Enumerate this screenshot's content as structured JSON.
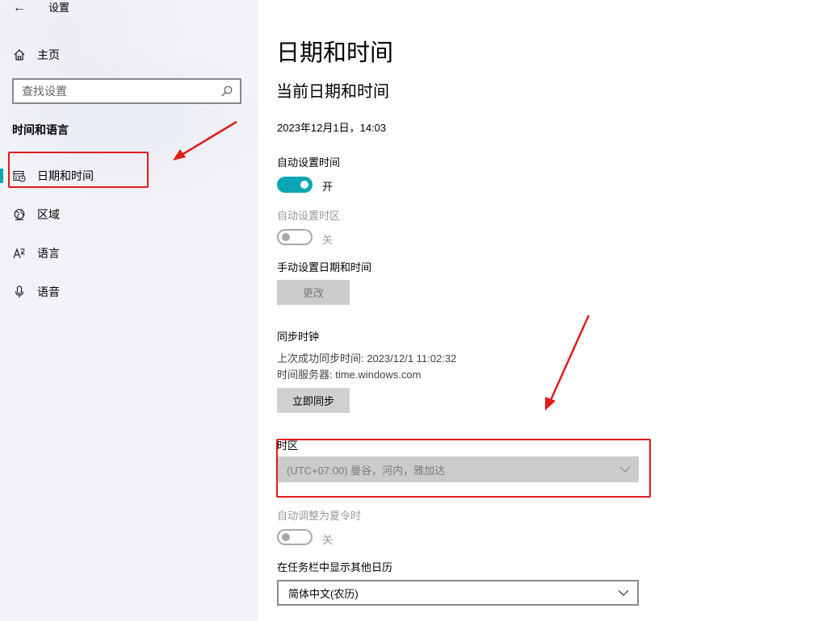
{
  "window": {
    "title": "设置",
    "back_glyph": "←"
  },
  "sidebar": {
    "home_label": "主页",
    "search_placeholder": "查找设置",
    "section_title": "时间和语言",
    "items": [
      {
        "label": "日期和时间",
        "icon": "calendar-clock-icon",
        "selected": true
      },
      {
        "label": "区域",
        "icon": "globe-icon",
        "selected": false
      },
      {
        "label": "语言",
        "icon": "language-icon",
        "selected": false
      },
      {
        "label": "语音",
        "icon": "microphone-icon",
        "selected": false
      }
    ]
  },
  "main": {
    "page_title": "日期和时间",
    "section_title": "当前日期和时间",
    "current_datetime": "2023年12月1日，14:03",
    "auto_time": {
      "label": "自动设置时间",
      "state": "开",
      "on": true
    },
    "auto_timezone": {
      "label": "自动设置时区",
      "state": "关",
      "on": false
    },
    "manual": {
      "label": "手动设置日期和时间",
      "button": "更改"
    },
    "sync": {
      "label": "同步时钟",
      "last_sync": "上次成功同步时间: 2023/12/1 11:02:32",
      "server": "时间服务器: time.windows.com",
      "button": "立即同步"
    },
    "timezone": {
      "label": "时区",
      "value": "(UTC+07:00) 曼谷，河内，雅加达"
    },
    "dst": {
      "label": "自动调整为夏令时",
      "state": "关",
      "on": false
    },
    "calendar": {
      "label": "在任务栏中显示其他日历",
      "value": "简体中文(农历)"
    }
  },
  "colors": {
    "accent": "#0aa6b5",
    "highlight": "#e21a1a",
    "nav_accent": "#00aaaa"
  }
}
